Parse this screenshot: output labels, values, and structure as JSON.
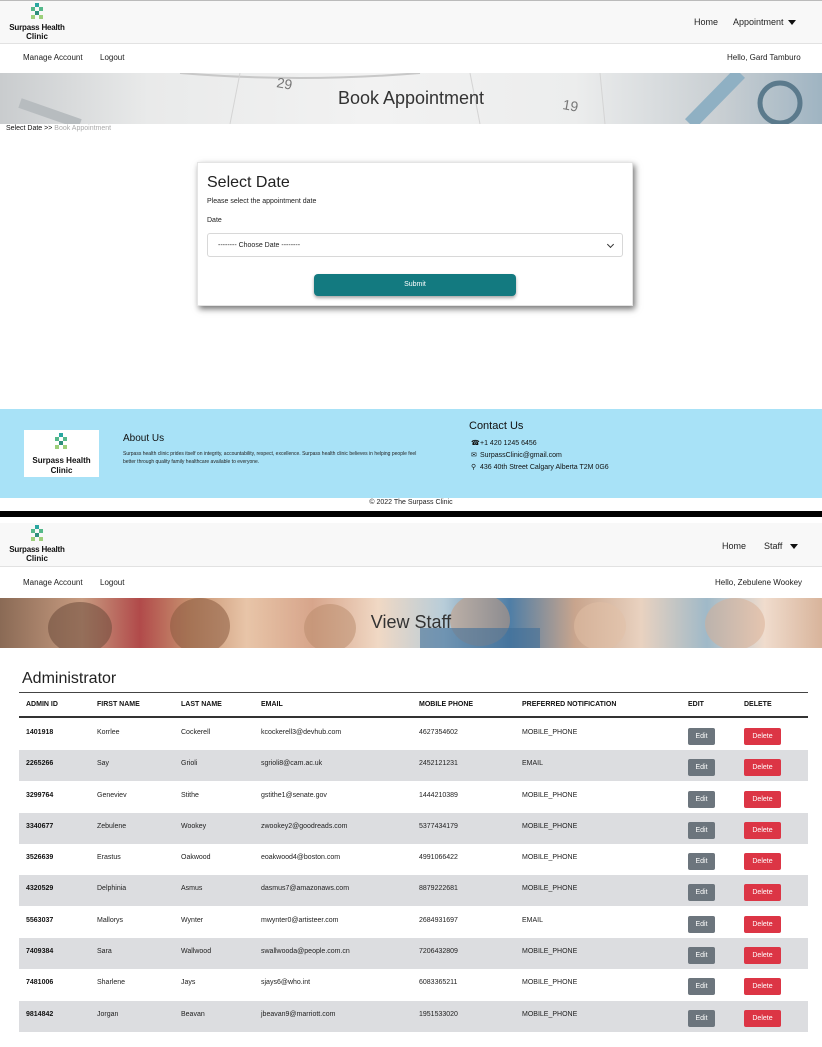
{
  "brand": {
    "line1": "Surpass Health",
    "line2": "Clinic"
  },
  "page1": {
    "nav": {
      "home": "Home",
      "menu": "Appointment"
    },
    "account": {
      "manage": "Manage Account",
      "logout": "Logout",
      "greeting": "Hello, Gard Tamburo"
    },
    "banner_title": "Book Appointment",
    "breadcrumb": {
      "current": "Select Date",
      "sep": ">>",
      "next": "Book Appointment"
    },
    "card": {
      "title": "Select Date",
      "description": "Please select the appointment date",
      "date_label": "Date",
      "date_select_value": "-------- Choose Date --------",
      "submit_label": "Submit"
    },
    "footer": {
      "about_title": "About Us",
      "about_text": "Surpass health clinic prides itself on integrity, accountability, respect, excellence. Surpass health clinic believes in helping people feel better through quality family healthcare available to everyone.",
      "contact_title": "Contact Us",
      "phone": "+1 420 1245 6456",
      "email": "SurpassClinic@gmail.com",
      "address": "436 40th Street Calgary Alberta T2M 0G6",
      "copyright": "© 2022 The Surpass Clinic"
    },
    "icons": {
      "phone": "phone-icon",
      "email": "envelope-icon",
      "address": "map-marker-icon"
    }
  },
  "page2": {
    "nav": {
      "home": "Home",
      "menu": "Staff"
    },
    "account": {
      "manage": "Manage Account",
      "logout": "Logout",
      "greeting": "Hello, Zebulene Wookey"
    },
    "banner_title": "View Staff",
    "section_title": "Administrator",
    "columns": [
      "ADMIN ID",
      "FIRST NAME",
      "LAST NAME",
      "EMAIL",
      "MOBILE PHONE",
      "PREFERRED NOTIFICATION",
      "EDIT",
      "DELETE"
    ],
    "edit_label": "Edit",
    "delete_label": "Delete",
    "rows": [
      {
        "id": "1401918",
        "first": "Korrlee",
        "last": "Cockerell",
        "email": "kcockerell3@devhub.com",
        "phone": "4627354602",
        "notification": "MOBILE_PHONE"
      },
      {
        "id": "2265266",
        "first": "Say",
        "last": "Grioli",
        "email": "sgrioli8@cam.ac.uk",
        "phone": "2452121231",
        "notification": "EMAIL"
      },
      {
        "id": "3299764",
        "first": "Geneviev",
        "last": "Stithe",
        "email": "gstithe1@senate.gov",
        "phone": "1444210389",
        "notification": "MOBILE_PHONE"
      },
      {
        "id": "3340677",
        "first": "Zebulene",
        "last": "Wookey",
        "email": "zwookey2@goodreads.com",
        "phone": "5377434179",
        "notification": "MOBILE_PHONE"
      },
      {
        "id": "3526639",
        "first": "Erastus",
        "last": "Oakwood",
        "email": "eoakwood4@boston.com",
        "phone": "4991066422",
        "notification": "MOBILE_PHONE"
      },
      {
        "id": "4320529",
        "first": "Delphinia",
        "last": "Asmus",
        "email": "dasmus7@amazonaws.com",
        "phone": "8879222681",
        "notification": "MOBILE_PHONE"
      },
      {
        "id": "5563037",
        "first": "Mallorys",
        "last": "Wynter",
        "email": "mwynter0@artisteer.com",
        "phone": "2684931697",
        "notification": "EMAIL"
      },
      {
        "id": "7409384",
        "first": "Sara",
        "last": "Wallwood",
        "email": "swallwooda@people.com.cn",
        "phone": "7206432809",
        "notification": "MOBILE_PHONE"
      },
      {
        "id": "7481006",
        "first": "Sharlene",
        "last": "Jays",
        "email": "sjays6@who.int",
        "phone": "6083365211",
        "notification": "MOBILE_PHONE"
      },
      {
        "id": "9814842",
        "first": "Jorgan",
        "last": "Beavan",
        "email": "jbeavan9@marriott.com",
        "phone": "1951533020",
        "notification": "MOBILE_PHONE"
      }
    ]
  },
  "colors": {
    "primary_teal": "#137a80",
    "footer_bg": "#a8e2f7",
    "edit_gray": "#6c757d",
    "delete_red": "#dc3545",
    "row_alt": "#dcdde0"
  }
}
